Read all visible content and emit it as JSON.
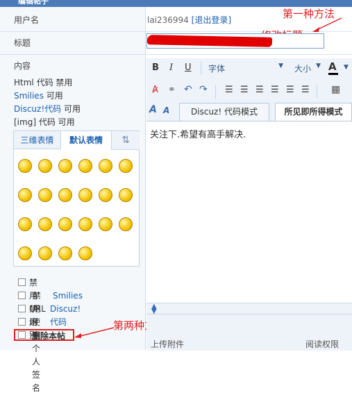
{
  "header": {
    "title": "编辑帖子"
  },
  "labels": {
    "username": "用户名",
    "title": "标题",
    "content": "内容"
  },
  "user": {
    "name": "lai236994",
    "logout": "[退出登录]"
  },
  "title_field": {
    "value": ""
  },
  "annotations": {
    "method1": "第一种方法",
    "edit_title": "修改标题",
    "method2": "第两种方法"
  },
  "info": {
    "html_code": "Html 代码",
    "disabled": "禁用",
    "smilies": "Smilies",
    "available": "可用",
    "discuz_code": "Discuz!代码",
    "img_code": "[img] 代码"
  },
  "smiley_tabs": {
    "tab1": "三维表情",
    "tab2": "默认表情"
  },
  "smileys": [
    "smile",
    "frown",
    "tongue",
    "blush",
    "grin",
    "wink",
    "sweat",
    "angry",
    "mad",
    "cry",
    "whistle",
    "love",
    "thumbs-down-hand",
    "hand",
    "peace",
    "handshake",
    "annoyed",
    "happy",
    "cheer",
    "lips",
    "clock",
    "phone"
  ],
  "options": {
    "disable_url": "禁用  URL 识别",
    "disable_smilies_prefix": "禁用",
    "disable_smilies_link": "Smilies",
    "disable_discuz_prefix": "禁用",
    "disable_discuz_link": "Discuz!代码",
    "use_signature": "使用个人签名",
    "delete_post": "删除本帖"
  },
  "toolbar": {
    "font": "字体",
    "size": "大小"
  },
  "editor_tabs": {
    "code_mode": "Discuz! 代码模式",
    "wysiwyg": "所见即所得模式"
  },
  "editor": {
    "content": "关注下.希望有高手解决."
  },
  "bottom": {
    "upload": "上传附件",
    "perm": "阅读权限"
  },
  "colors": {
    "header": "#4a7ab8",
    "accent_red": "#e02020",
    "link": "#1a5fae"
  }
}
